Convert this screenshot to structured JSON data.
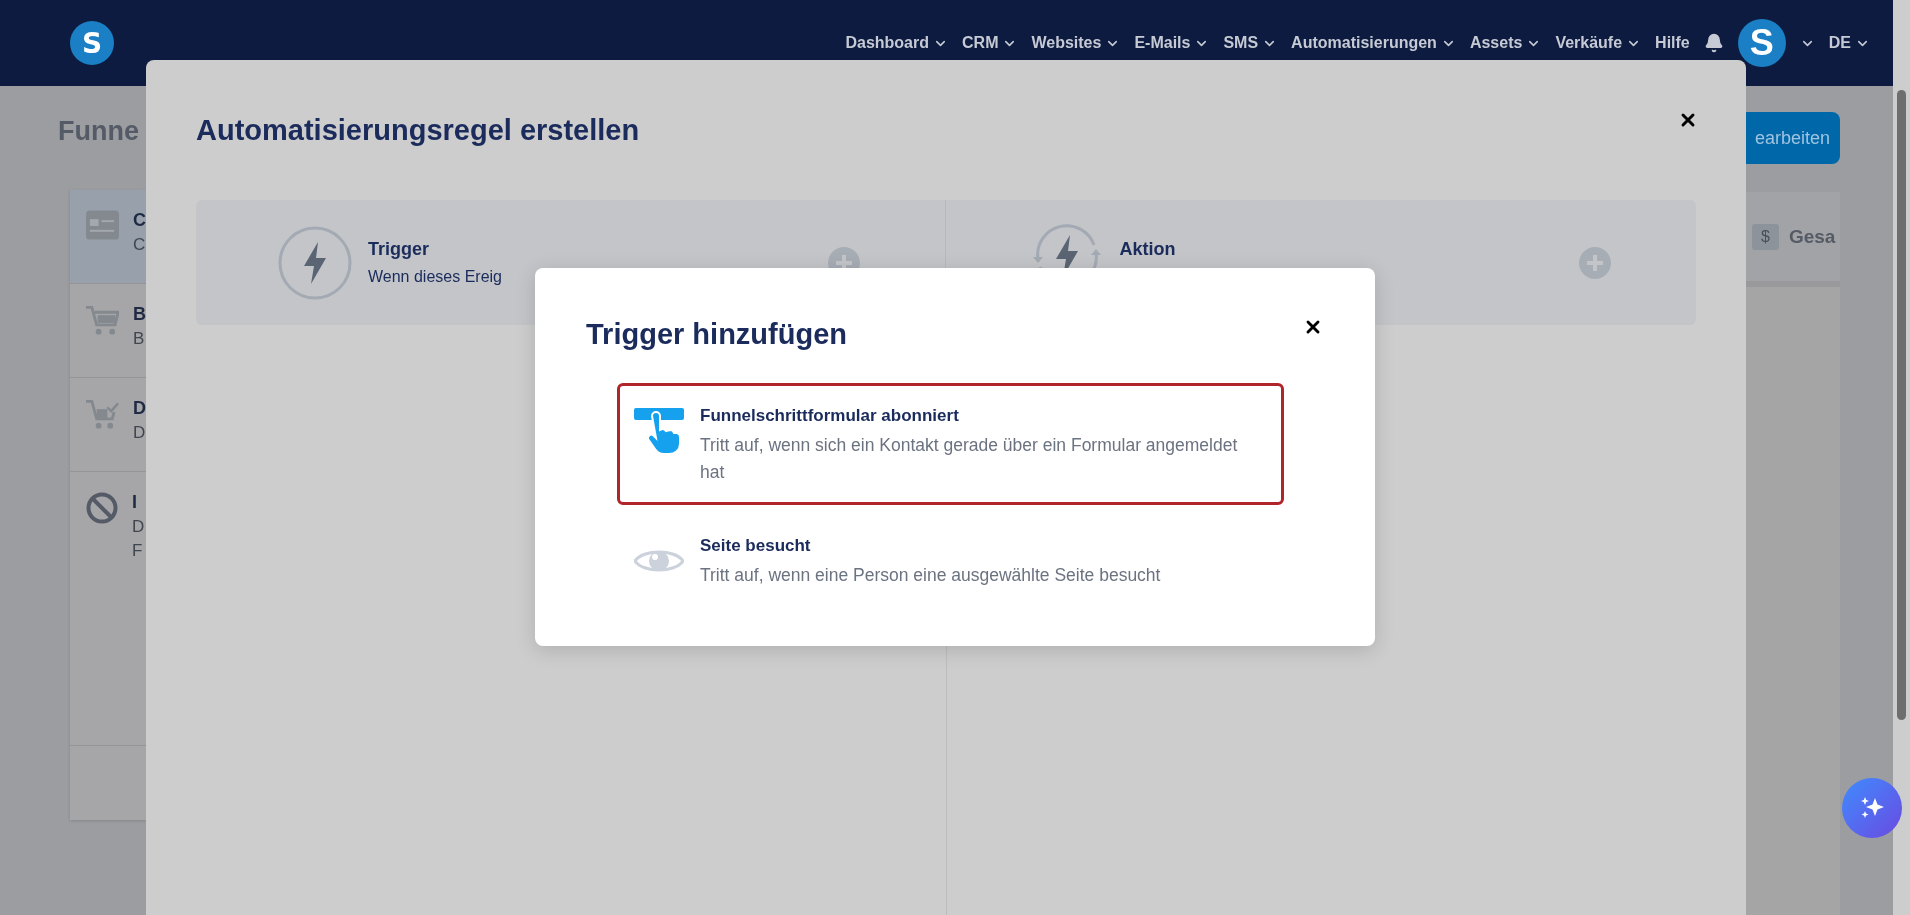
{
  "nav": {
    "logo": "S",
    "items": [
      {
        "label": "Dashboard",
        "dropdown": true
      },
      {
        "label": "CRM",
        "dropdown": true
      },
      {
        "label": "Websites",
        "dropdown": true
      },
      {
        "label": "E-Mails",
        "dropdown": true
      },
      {
        "label": "SMS",
        "dropdown": true
      },
      {
        "label": "Automatisierungen",
        "dropdown": true
      },
      {
        "label": "Assets",
        "dropdown": true
      },
      {
        "label": "Verkäufe",
        "dropdown": true
      },
      {
        "label": "Hilfe",
        "dropdown": false
      }
    ],
    "avatar": "S",
    "language": "DE"
  },
  "page": {
    "title": "Funne",
    "edit_button": "earbeiten",
    "list": [
      {
        "kind": "card",
        "title": "C",
        "lines": [
          "C"
        ],
        "selected": true
      },
      {
        "kind": "cart",
        "title": "B",
        "lines": [
          "B"
        ],
        "selected": false
      },
      {
        "kind": "cart-check",
        "title": "D",
        "lines": [
          "D"
        ],
        "selected": false
      },
      {
        "kind": "ban",
        "title": "I",
        "lines": [
          "D",
          "F"
        ],
        "selected": false
      }
    ],
    "summary": {
      "badge": "$",
      "label": "Gesa"
    }
  },
  "rule_dialog": {
    "title": "Automatisierungsregel erstellen",
    "panels": [
      {
        "kind": "bolt",
        "title": "Trigger",
        "subtitle": "Wenn dieses Ereig"
      },
      {
        "kind": "cycle",
        "title": "Aktion"
      }
    ]
  },
  "trigger_dialog": {
    "title": "Trigger hinzufügen",
    "options": [
      {
        "kind": "form",
        "title": "Funnelschrittformular abonniert",
        "description": "Tritt auf, wenn sich ein Kontakt gerade über ein Formular angemeldet hat",
        "selected": true
      },
      {
        "kind": "eye",
        "title": "Seite besucht",
        "description": "Tritt auf, wenn eine Person eine ausgewählte Seite besucht",
        "selected": false
      }
    ]
  }
}
